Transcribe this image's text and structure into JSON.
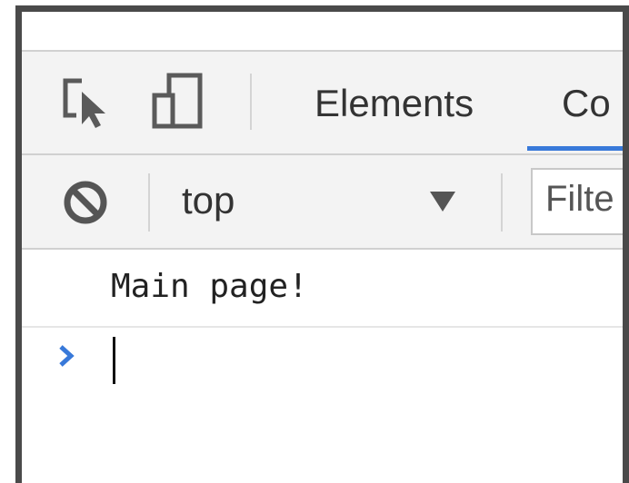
{
  "tabs": [
    {
      "label": "Elements"
    },
    {
      "label": "Co",
      "active": true
    }
  ],
  "toolbar": {
    "inspect_icon": "inspect-element-icon",
    "device_icon": "device-toolbar-icon"
  },
  "console_toolbar": {
    "clear_icon": "clear-console-icon",
    "context": "top",
    "filter_placeholder": "Filte"
  },
  "console": {
    "messages": [
      "Main page!"
    ],
    "prompt_icon": "chevron-right-icon"
  },
  "colors": {
    "frame": "#4a4a4a",
    "toolbar_bg": "#f3f3f3",
    "accent": "#3879d9",
    "prompt": "#3879d9"
  }
}
